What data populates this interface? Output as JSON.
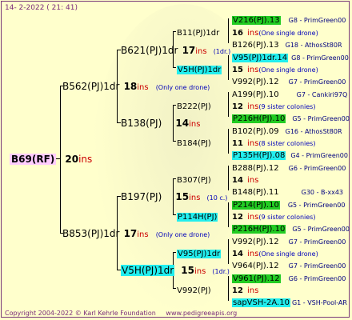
{
  "header": {
    "date": "14-  2-2022 ( 21: 41)"
  },
  "root": {
    "name": "B69(RF)",
    "gen": "20",
    "ins": "ins"
  },
  "g1": [
    {
      "name": "B562(PJ)1dr",
      "gen": "18",
      "ins": "ins",
      "note": "(Only one drone)"
    },
    {
      "name": "B853(PJ)1dr",
      "gen": "17",
      "ins": "ins",
      "note": "(Only one drone)"
    }
  ],
  "g2": [
    {
      "name": "B621(PJ)1dr",
      "gen": "17",
      "ins": "ins",
      "note": "(1dr.)"
    },
    {
      "name": "B138(PJ)",
      "gen": "14",
      "ins": "ins",
      "note": ""
    },
    {
      "name": "B197(PJ)",
      "gen": "15",
      "ins": "ins",
      "note": "(10 c.)"
    },
    {
      "name": "V5H(PJ)1dr",
      "gen": "15",
      "ins": "ins",
      "note": "(1dr.)"
    }
  ],
  "g3": [
    {
      "name": "B11(PJ)1dr",
      "gen": "16",
      "ins": "ins",
      "note": "(One single drone)"
    },
    {
      "name": "V5H(PJ)1dr",
      "gen": "15",
      "ins": "ins",
      "note": "(One single drone)"
    },
    {
      "name": "B222(PJ)",
      "gen": "12",
      "ins": "ins",
      "note": "(9 sister colonies)"
    },
    {
      "name": "B184(PJ)",
      "gen": "11",
      "ins": "ins",
      "note": "(8 sister colonies)"
    },
    {
      "name": "B307(PJ)",
      "gen": "14",
      "ins": "ins",
      "note": ""
    },
    {
      "name": "P114H(PJ)",
      "gen": "12",
      "ins": "ins",
      "note": "(9 sister colonies)"
    },
    {
      "name": "V95(PJ)1dr",
      "gen": "14",
      "ins": "ins",
      "note": "(One single drone)"
    },
    {
      "name": "V992(PJ)",
      "gen": "12",
      "ins": "ins",
      "note": ""
    }
  ],
  "g4": [
    {
      "name": "V216(PJ).13",
      "code": "G8 - PrimGreen00"
    },
    {
      "name": "B126(PJ).13",
      "code": "G18 - AthosSt80R"
    },
    {
      "name": "V95(PJ)1dr.14",
      "code": "G8 - PrimGreen00"
    },
    {
      "name": "V992(PJ).12",
      "code": "G7 - PrimGreen00"
    },
    {
      "name": "A199(PJ).10",
      "code": "G7 - Cankiri97Q"
    },
    {
      "name": "P216H(PJ).10",
      "code": "G5 - PrimGreen00"
    },
    {
      "name": "B102(PJ).09",
      "code": "G16 - AthosSt80R"
    },
    {
      "name": "P135H(PJ).08",
      "code": "G4 - PrimGreen00"
    },
    {
      "name": "B288(PJ).12",
      "code": "G6 - PrimGreen00"
    },
    {
      "name": "B148(PJ).11",
      "code": "G30 - B-xx43"
    },
    {
      "name": "P214(PJ).10",
      "code": "G5 - PrimGreen00"
    },
    {
      "name": "P216H(PJ).10",
      "code": "G5 - PrimGreen00"
    },
    {
      "name": "V992(PJ).12",
      "code": "G7 - PrimGreen00"
    },
    {
      "name": "V964(PJ).12",
      "code": "G7 - PrimGreen00"
    },
    {
      "name": "V961(PJ).12",
      "code": "G6 - PrimGreen00"
    },
    {
      "name": "sapVSH-2A.10",
      "code": "G1 - VSH-Pool-AR"
    }
  ],
  "footer": {
    "copyright": "Copyright 2004-2022 © Karl Kehrle Foundation",
    "site": "www.pedigreeapis.org"
  }
}
